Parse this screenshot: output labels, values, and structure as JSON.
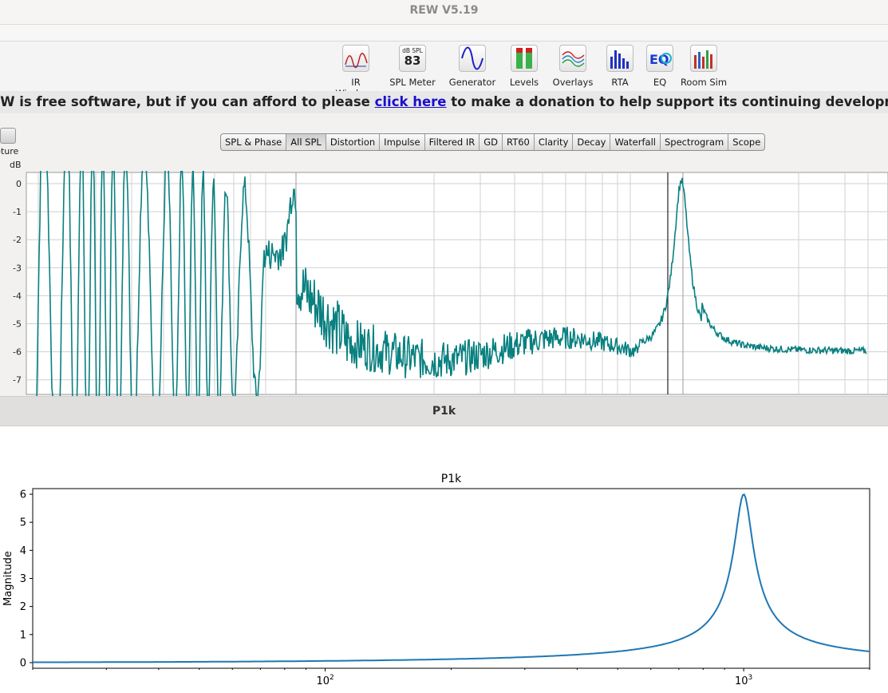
{
  "window": {
    "title": "REW V5.19"
  },
  "toolbar": {
    "items": [
      {
        "label": "IR Windows",
        "icon": "ir-windows-icon"
      },
      {
        "label": "SPL Meter",
        "icon": "spl-meter-icon",
        "meter_unit": "dB SPL",
        "meter_value": "83"
      },
      {
        "label": "Generator",
        "icon": "generator-icon"
      },
      {
        "label": "Levels",
        "icon": "levels-icon"
      },
      {
        "label": "Overlays",
        "icon": "overlays-icon"
      },
      {
        "label": "RTA",
        "icon": "rta-icon"
      },
      {
        "label": "EQ",
        "icon": "eq-icon"
      },
      {
        "label": "Room Sim",
        "icon": "room-sim-icon"
      }
    ]
  },
  "banner": {
    "text_before": "EW is free software, but if you can afford to please ",
    "link_text": "click here",
    "text_after": " to make a donation to help support its continuing development"
  },
  "graph_panel": {
    "capture_label": "pture",
    "unit_label": "dB",
    "tabs": [
      "SPL & Phase",
      "All SPL",
      "Distortion",
      "Impulse",
      "Filtered IR",
      "GD",
      "RT60",
      "Clarity",
      "Decay",
      "Waterfall",
      "Spectrogram",
      "Scope"
    ],
    "active_tab": "All SPL",
    "y_ticks": [
      "0",
      "-1",
      "-2",
      "-3",
      "-4",
      "-5",
      "-6",
      "-7"
    ],
    "trace_color": "#0a8080"
  },
  "measurement_name": "P1k",
  "chart_data": {
    "type": "line",
    "title": "P1k",
    "xlabel": "",
    "ylabel": "Magnitude",
    "xscale": "log",
    "xlim": [
      20,
      2000
    ],
    "ylim": [
      -0.2,
      6.2
    ],
    "yticks": [
      0,
      1,
      2,
      3,
      4,
      5,
      6
    ],
    "xtick_labels": [
      "10^2",
      "10^3"
    ],
    "peak": {
      "x": 1000,
      "y": 6.0
    },
    "series": [
      {
        "values_description_model": "resonance",
        "color": "#1f77b4"
      }
    ]
  }
}
